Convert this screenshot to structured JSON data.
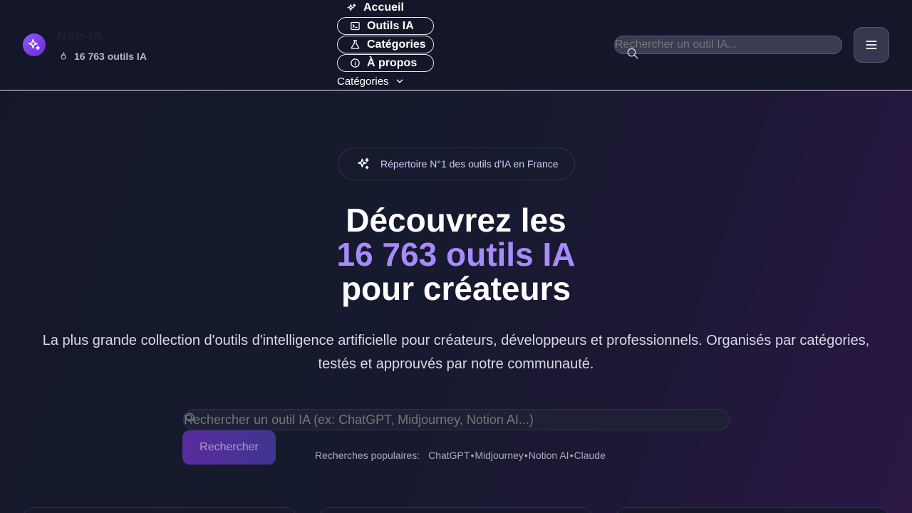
{
  "brand": {
    "name": "Neo-IA",
    "tool_count": "16 763 outils IA"
  },
  "nav": {
    "items": [
      {
        "label": "Accueil",
        "icon": "sparkles-icon"
      },
      {
        "label": "Outils IA",
        "icon": "terminal-icon"
      },
      {
        "label": "Catégories",
        "icon": "flask-icon"
      },
      {
        "label": "À propos",
        "icon": "info-icon"
      }
    ],
    "categories_dropdown": "Catégories"
  },
  "header_search": {
    "placeholder": "Rechercher un outil IA..."
  },
  "hero": {
    "badge": "Répertoire N°1 des outils d'IA en France",
    "title_line1": "Découvrez les",
    "title_line2": "16 763 outils IA",
    "title_line3": "pour créateurs",
    "description": "La plus grande collection d'outils d'intelligence artificielle pour créateurs, développeurs et professionnels. Organisés par catégories, testés et approuvés par notre communauté."
  },
  "search": {
    "placeholder": "Rechercher un outil IA (ex: ChatGPT, Midjourney, Notion AI...)",
    "button": "Rechercher",
    "popular_label": "Recherches populaires:",
    "popular": [
      "ChatGPT",
      "Midjourney",
      "Notion AI",
      "Claude"
    ],
    "separator": "•"
  },
  "colors": {
    "accent": "#a78bfa",
    "background": "#131729",
    "badge_text": "#d9c9fb"
  }
}
